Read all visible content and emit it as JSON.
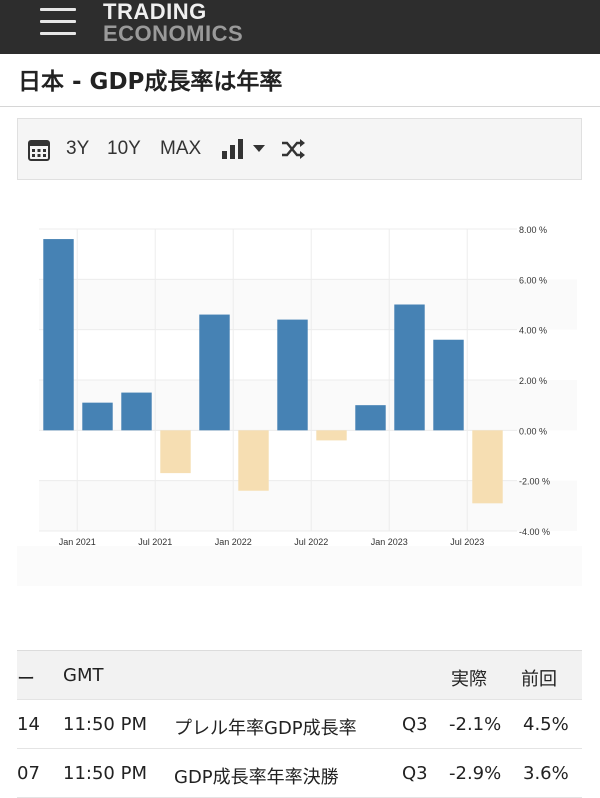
{
  "header": {
    "logo_line1": "TRADING",
    "logo_line2": "ECONOMICS",
    "menu_icon": "hamburger-menu-icon"
  },
  "page_title": "日本 - GDP成長率は年率",
  "toolbar": {
    "calendar_icon": "calendar-icon",
    "range_3y": "3Y",
    "range_10y": "10Y",
    "range_max": "MAX",
    "chart_type_icon": "bar-chart-icon",
    "dropdown_icon": "caret-down-icon",
    "shuffle_icon": "shuffle-icon"
  },
  "chart_data": {
    "type": "bar",
    "x": [
      "2020Q4",
      "2021Q1",
      "2021Q2",
      "2021Q3",
      "2021Q4",
      "2022Q1",
      "2022Q2",
      "2022Q3",
      "2022Q4",
      "2023Q1",
      "2023Q2",
      "2023Q3"
    ],
    "values": [
      7.6,
      1.1,
      1.5,
      -1.7,
      4.6,
      -2.4,
      4.4,
      -0.4,
      1.0,
      5.0,
      3.6,
      -2.9
    ],
    "x_tick_labels": [
      "Jan 2021",
      "Jul 2021",
      "Jan 2022",
      "Jul 2022",
      "Jan 2023",
      "Jul 2023"
    ],
    "y_tick_labels": [
      "8.00 %",
      "6.00 %",
      "4.00 %",
      "2.00 %",
      "0.00 %",
      "-2.00 %",
      "-4.00 %"
    ],
    "ylim": [
      -4,
      8
    ],
    "positive_color": "#4682b4",
    "negative_color": "#f6deb2",
    "grid": true
  },
  "table": {
    "headers": [
      "ー",
      "GMT",
      "実際",
      "前回"
    ],
    "rows": [
      {
        "date": "14",
        "time": "11:50 PM",
        "event": "プレル年率GDP成長率",
        "ref": "Q3",
        "actual": "-2.1%",
        "previous": "4.5%"
      },
      {
        "date": "07",
        "time": "11:50 PM",
        "event": "GDP成長率年率決勝",
        "ref": "Q3",
        "actual": "-2.9%",
        "previous": "3.6%"
      }
    ]
  }
}
